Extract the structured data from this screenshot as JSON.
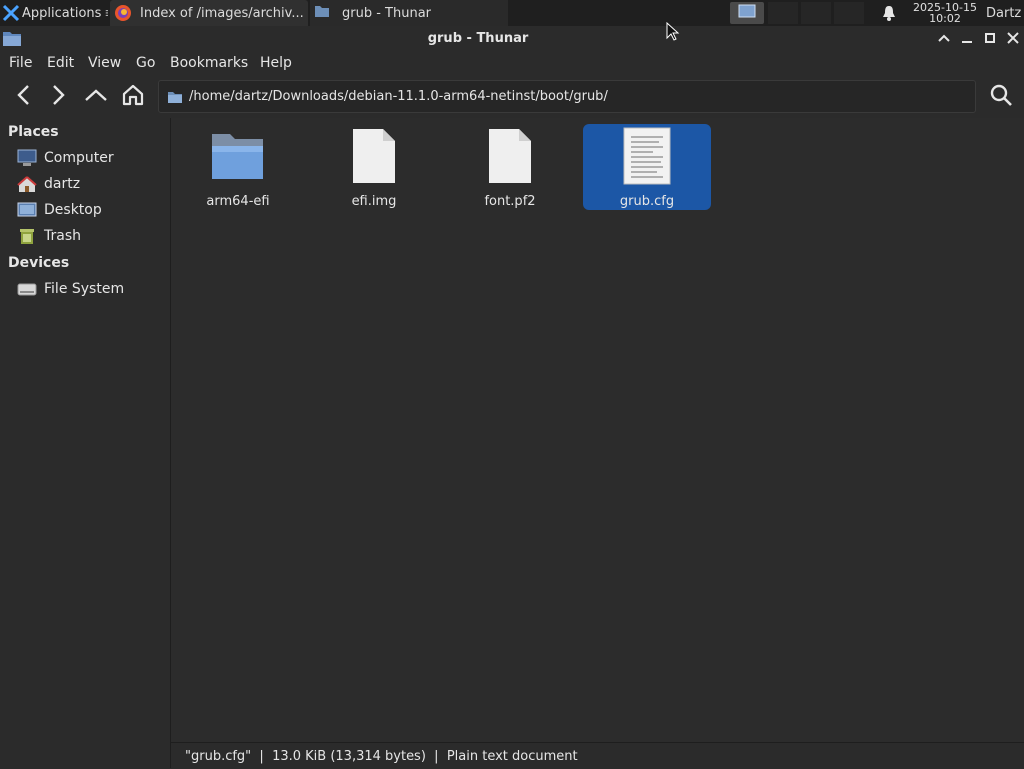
{
  "panel": {
    "apps_label": "Applications",
    "tasks": [
      {
        "label": "Index of /images/archiv..."
      },
      {
        "label": "grub - Thunar"
      }
    ],
    "clock": {
      "date": "2025-10-15",
      "time": "10:02"
    },
    "user": "Dartz"
  },
  "window": {
    "title": "grub - Thunar"
  },
  "menu": {
    "items": [
      "File",
      "Edit",
      "View",
      "Go",
      "Bookmarks",
      "Help"
    ]
  },
  "location": {
    "path": "/home/dartz/Downloads/debian-11.1.0-arm64-netinst/boot/grub/"
  },
  "sidebar": {
    "places_heading": "Places",
    "places": [
      {
        "label": "Computer",
        "icon": "computer-icon"
      },
      {
        "label": "dartz",
        "icon": "home-folder-icon"
      },
      {
        "label": "Desktop",
        "icon": "desktop-icon"
      },
      {
        "label": "Trash",
        "icon": "trash-icon"
      }
    ],
    "devices_heading": "Devices",
    "devices": [
      {
        "label": "File System",
        "icon": "drive-icon"
      }
    ]
  },
  "files": [
    {
      "name": "arm64-efi",
      "icon": "folder-icon",
      "selected": false
    },
    {
      "name": "efi.img",
      "icon": "document-icon",
      "selected": false
    },
    {
      "name": "font.pf2",
      "icon": "document-icon",
      "selected": false
    },
    {
      "name": "grub.cfg",
      "icon": "text-document-icon",
      "selected": true
    }
  ],
  "status": {
    "text": "\"grub.cfg\"  |  13.0 KiB (13,314 bytes)  |  Plain text document"
  },
  "colors": {
    "selection": "#1c57a6",
    "background": "#2c2c2c",
    "panel": "#1f1f1f"
  }
}
